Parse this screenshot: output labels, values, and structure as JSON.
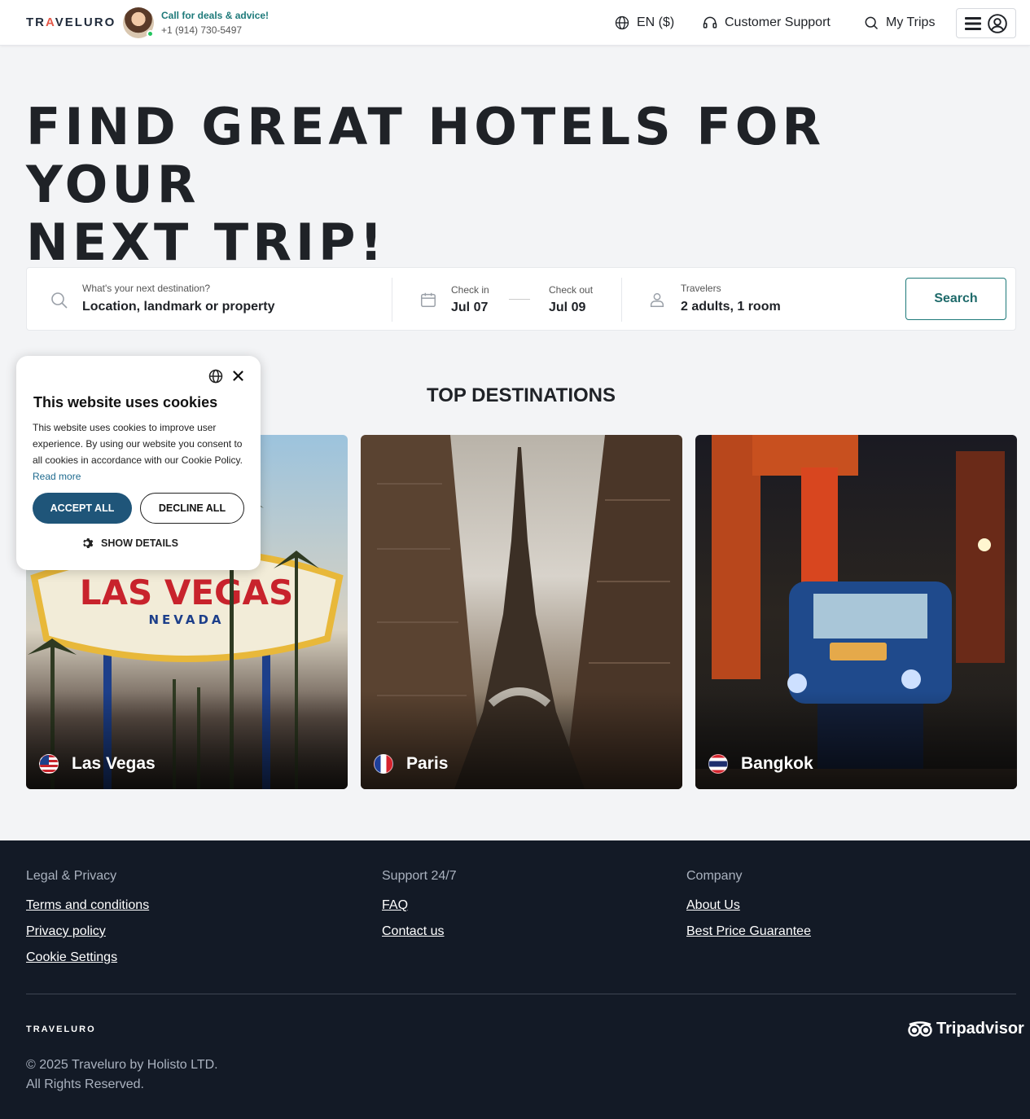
{
  "header": {
    "logo_text": "TRAVELURO",
    "deals_text": "Call for deals & advice!",
    "phone": "+1 (914) 730-5497",
    "language": "EN ($)",
    "support": "Customer Support",
    "trips": "My Trips"
  },
  "hero": {
    "title_line1": "FIND GREAT HOTELS FOR YOUR",
    "title_line2": "NEXT TRIP!"
  },
  "search": {
    "destination_label": "What's your next destination?",
    "destination_placeholder": "Location, landmark or property",
    "checkin_label": "Check in",
    "checkin_value": "Jul 07",
    "checkout_label": "Check out",
    "checkout_value": "Jul 09",
    "travelers_label": "Travelers",
    "travelers_value": "2 adults, 1 room",
    "button": "Search"
  },
  "destinations": {
    "title": "TOP DESTINATIONS",
    "cards": [
      {
        "city": "Las Vegas",
        "flag": "us-flag"
      },
      {
        "city": "Paris",
        "flag": "fr-flag"
      },
      {
        "city": "Bangkok",
        "flag": "th-flag"
      }
    ]
  },
  "cookie": {
    "title": "This website uses cookies",
    "body": "This website uses cookies to improve user experience. By using our website you consent to all cookies in accordance with our Cookie Policy.",
    "read_more": "Read more",
    "accept": "ACCEPT ALL",
    "decline": "DECLINE ALL",
    "show_details": "SHOW DETAILS"
  },
  "footer": {
    "col1_head": "Legal & Privacy",
    "col1_links": [
      "Terms and conditions",
      "Privacy policy",
      "Cookie Settings"
    ],
    "col2_head": "Support 24/7",
    "col2_links": [
      "FAQ",
      "Contact us"
    ],
    "col3_head": "Company",
    "col3_links": [
      "About Us",
      "Best Price Guarantee"
    ],
    "logo_text": "TRAVELURO",
    "tripadvisor": "Tripadvisor",
    "copyright_line1": "© 2025 Traveluro by Holisto LTD.",
    "copyright_line2": "All Rights Reserved."
  },
  "colors": {
    "accent_teal": "#1e7a7a",
    "cookie_accept": "#1f5579",
    "footer_bg": "#131a26",
    "page_bg": "#f3f4f6"
  }
}
